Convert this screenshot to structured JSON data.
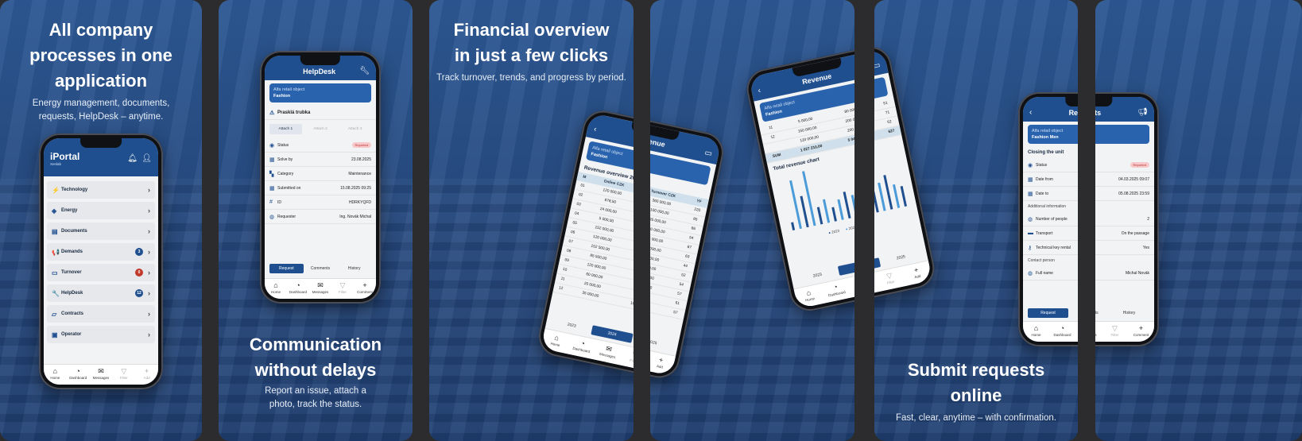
{
  "colors": {
    "primary": "#1f4f8f",
    "panel_bg": "#26497e",
    "badge_blue": "#1f4f8f",
    "badge_red": "#c0392b",
    "status_pill": "#f7c9cb"
  },
  "panel1": {
    "title": "All company processes in one application",
    "subtitle": "Energy management, documents, requests, HelpDesk – anytime.",
    "app": {
      "logo": "iPortal",
      "logo_sub": "Xenlab",
      "menu": [
        {
          "label": "Technology",
          "icon": "lightning-icon",
          "glyph": "⚡",
          "badge": ""
        },
        {
          "label": "Energy",
          "icon": "tag-icon",
          "glyph": "◈",
          "badge": ""
        },
        {
          "label": "Documents",
          "icon": "document-icon",
          "glyph": "▤",
          "badge": ""
        },
        {
          "label": "Demands",
          "icon": "megaphone-icon",
          "glyph": "📢",
          "badge": "3",
          "badge_color": "#1f4f8f"
        },
        {
          "label": "Turnover",
          "icon": "wallet-icon",
          "glyph": "▭",
          "badge": "0",
          "badge_color": "#c0392b"
        },
        {
          "label": "HelpDesk",
          "icon": "wrench-icon",
          "glyph": "🔧",
          "badge": "12",
          "badge_color": "#1f4f8f"
        },
        {
          "label": "Contracts",
          "icon": "folder-icon",
          "glyph": "▱",
          "badge": ""
        },
        {
          "label": "Operator",
          "icon": "id-card-icon",
          "glyph": "▣",
          "badge": ""
        }
      ],
      "tabbar": [
        {
          "label": "Home",
          "icon": "home-icon",
          "glyph": "⌂"
        },
        {
          "label": "Dashboard",
          "icon": "dashboard-icon",
          "glyph": "◔"
        },
        {
          "label": "Messages",
          "icon": "mail-icon",
          "glyph": "✉"
        },
        {
          "label": "Filter",
          "icon": "filter-icon",
          "glyph": "▽"
        },
        {
          "label": "Add",
          "icon": "plus-icon",
          "glyph": "+"
        }
      ]
    }
  },
  "panel2": {
    "title": "Communication without delays",
    "subtitle": "Report an issue, attach a photo, track the status.",
    "app": {
      "header": "HelpDesk",
      "object_label": "Alfa retail object",
      "object_name": "Fashion",
      "issue_title": "Prasklá trubka",
      "attachments": [
        "Attach 1",
        "Attach 2",
        "Attach 3"
      ],
      "fields": [
        {
          "key": "Status",
          "value": "Reported",
          "pill": true,
          "icon": "status-icon",
          "glyph": "◉"
        },
        {
          "key": "Solve by",
          "value": "23.08.2025",
          "icon": "calendar-icon",
          "glyph": "▦"
        },
        {
          "key": "Category",
          "value": "Maintenance",
          "icon": "category-icon",
          "glyph": "▚"
        },
        {
          "key": "Submitted on",
          "value": "15.08.2025 09:25",
          "icon": "calendar-icon",
          "glyph": "▦"
        },
        {
          "key": "ID",
          "value": "HDRKYQFD",
          "icon": "hash-icon",
          "glyph": "#"
        },
        {
          "key": "Requester",
          "value": "Ing. Novák Michal",
          "icon": "user-icon",
          "glyph": "◍"
        }
      ],
      "segments": [
        "Request",
        "Comments",
        "History"
      ],
      "tabbar": [
        {
          "label": "Home",
          "icon": "home-icon",
          "glyph": "⌂"
        },
        {
          "label": "Dashboard",
          "icon": "dashboard-icon",
          "glyph": "◔"
        },
        {
          "label": "Messages",
          "icon": "mail-icon",
          "glyph": "✉"
        },
        {
          "label": "Filter",
          "icon": "filter-icon",
          "glyph": "▽"
        },
        {
          "label": "Comment",
          "icon": "plus-icon",
          "glyph": "+"
        }
      ]
    }
  },
  "panel3": {
    "title": "Financial overview in just a few clicks",
    "subtitle": "Track turnover, trends, and progress by period.",
    "app": {
      "header": "Revenue",
      "object_label": "Alfa retail object",
      "object_name": "Fashion",
      "table_title": "Revenue overview 2024",
      "columns": [
        "M",
        "Online CZK",
        "Turnover CZK",
        "YF"
      ],
      "rows": [
        [
          "01",
          "120 000,00",
          "360 000,00",
          "220"
        ],
        [
          "02",
          "878,50",
          "100 000,00",
          "85"
        ],
        [
          "03",
          "24 000,00",
          "95 000,00",
          "66"
        ],
        [
          "04",
          "5 000,00",
          "100 000,00",
          "54"
        ],
        [
          "05",
          "152 000,00",
          "175 000,00",
          "87"
        ],
        [
          "06",
          "120 000,00",
          "120 000,00",
          "63"
        ],
        [
          "07",
          "152 500,00",
          "125 000,00",
          "44"
        ],
        [
          "08",
          "85 500,00",
          "65 000,00",
          "52"
        ],
        [
          "09",
          "120 000,00",
          "90 000,00",
          "54"
        ],
        [
          "10",
          "60 000,00",
          "80 000,00",
          "57"
        ],
        [
          "11",
          "20 000,00",
          "95 000,00",
          "61"
        ],
        [
          "12",
          "35 000,00",
          "180 000,00",
          "57"
        ]
      ],
      "years": [
        "2023",
        "2024",
        "2025"
      ],
      "tabbar": [
        {
          "label": "Home",
          "icon": "home-icon",
          "glyph": "⌂"
        },
        {
          "label": "Dashboard",
          "icon": "dashboard-icon",
          "glyph": "◔"
        },
        {
          "label": "Messages",
          "icon": "mail-icon",
          "glyph": "✉"
        },
        {
          "label": "Filter",
          "icon": "filter-icon",
          "glyph": "▽"
        },
        {
          "label": "Add",
          "icon": "plus-icon",
          "glyph": "+"
        }
      ]
    }
  },
  "panel4": {
    "app": {
      "header": "Revenue",
      "object_label": "Alfa retail object",
      "object_name": "Fashion",
      "rows": [
        [
          "11",
          "5 000,00",
          "80 000,00",
          "51"
        ],
        [
          "12",
          "150 000,00",
          "200 000,00",
          "71"
        ],
        [
          "",
          "120 000,00",
          "200 000,00",
          "62"
        ]
      ],
      "sum_row": [
        "SUM",
        "1 027 210,00",
        "5 046 000,00",
        "627"
      ],
      "chart_title": "Total revenue chart",
      "chart_legend": [
        "2023",
        "2024",
        "2025"
      ],
      "years": [
        "2023",
        "2024",
        "2025"
      ],
      "tabbar": [
        {
          "label": "Home",
          "icon": "home-icon",
          "glyph": "⌂"
        },
        {
          "label": "Dashboard",
          "icon": "dashboard-icon",
          "glyph": "◔"
        },
        {
          "label": "Messages",
          "icon": "mail-icon",
          "glyph": "✉"
        },
        {
          "label": "Filter",
          "icon": "filter-icon",
          "glyph": "▽"
        },
        {
          "label": "Add",
          "icon": "plus-icon",
          "glyph": "+"
        }
      ]
    }
  },
  "panel5": {
    "title": "Submit requests online",
    "subtitle": "Fast, clear, anytime – with confirmation.",
    "app": {
      "header": "Requests",
      "object_label": "Alfa retail object",
      "object_name": "Fashion Men",
      "section1": "Closing the unit",
      "fields": [
        {
          "key": "Status",
          "value": "Reported",
          "pill": true,
          "icon": "status-icon",
          "glyph": "◉"
        },
        {
          "key": "Date from",
          "value": "04.03.2025 09:07",
          "icon": "calendar-icon",
          "glyph": "▦"
        },
        {
          "key": "Date to",
          "value": "05.08.2025 23:59",
          "icon": "calendar-icon",
          "glyph": "▦"
        }
      ],
      "section2": "Additional information",
      "fields2": [
        {
          "key": "Number of people",
          "value": "2",
          "icon": "people-icon",
          "glyph": "◍"
        },
        {
          "key": "Transport",
          "value": "On the passage",
          "icon": "truck-icon",
          "glyph": "▬"
        },
        {
          "key": "Technical key rental",
          "value": "Yes",
          "icon": "key-icon",
          "glyph": "⚷"
        }
      ],
      "section3": "Contact person",
      "fields3": [
        {
          "key": "Full name",
          "value": "Michal Novák",
          "icon": "user-icon",
          "glyph": "◍"
        }
      ],
      "segments": [
        "Request",
        "Comments",
        "History"
      ],
      "tabbar": [
        {
          "label": "Home",
          "icon": "home-icon",
          "glyph": "⌂"
        },
        {
          "label": "Dashboard",
          "icon": "dashboard-icon",
          "glyph": "◔"
        },
        {
          "label": "Messages",
          "icon": "mail-icon",
          "glyph": "✉"
        },
        {
          "label": "Filter",
          "icon": "filter-icon",
          "glyph": "▽"
        },
        {
          "label": "Comment",
          "icon": "plus-icon",
          "glyph": "+"
        }
      ]
    }
  }
}
